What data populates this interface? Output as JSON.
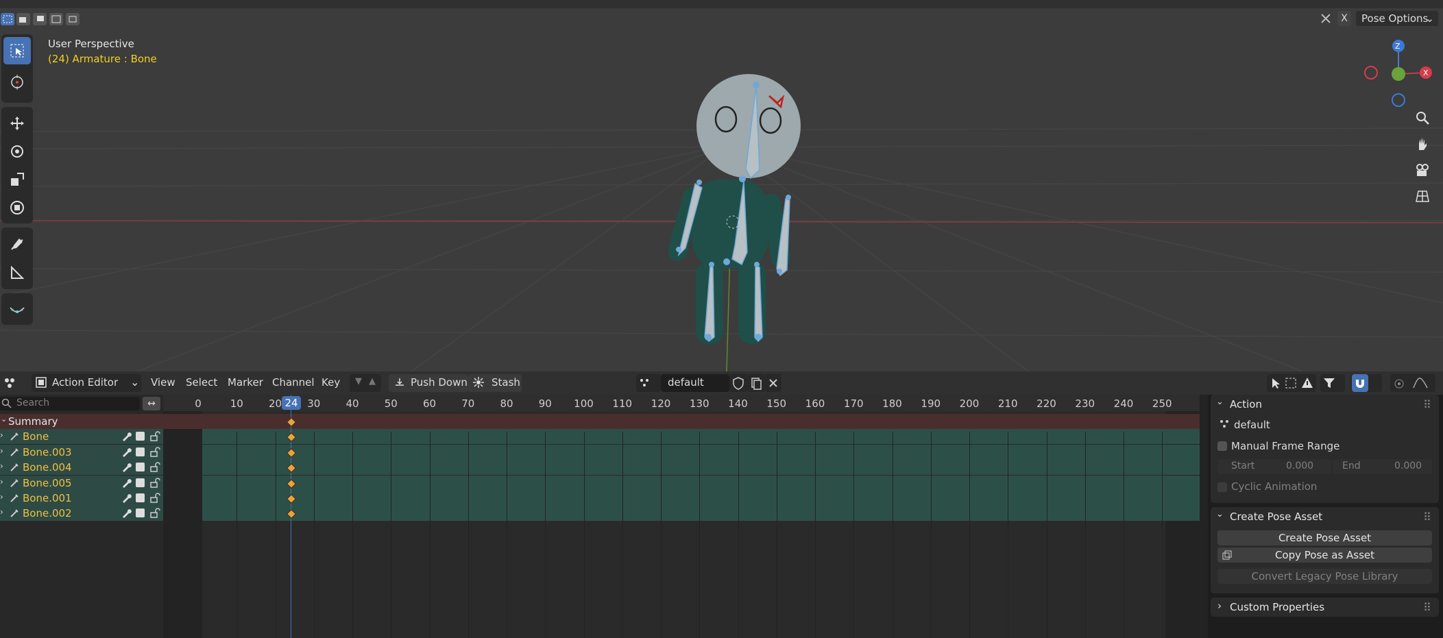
{
  "viewport": {
    "title": "User Perspective",
    "subtitle": "(24) Armature : Bone",
    "mode_label": "Pose Options",
    "x_label": "X",
    "axis_labels": {
      "z": "Z",
      "x": "X"
    }
  },
  "editor": {
    "editor_type": "Action Editor",
    "menus": [
      "View",
      "Select",
      "Marker",
      "Channel",
      "Key"
    ],
    "push_down": "Push Down",
    "stash": "Stash",
    "action_name": "default",
    "search_placeholder": "Search",
    "current_frame": "24",
    "frame_ticks": [
      "0",
      "10",
      "20",
      "30",
      "40",
      "50",
      "60",
      "70",
      "80",
      "90",
      "100",
      "110",
      "120",
      "130",
      "140",
      "150",
      "160",
      "170",
      "180",
      "190",
      "200",
      "210",
      "220",
      "230",
      "240",
      "250"
    ],
    "summary_label": "Summary",
    "channels": [
      "Bone",
      "Bone.003",
      "Bone.004",
      "Bone.005",
      "Bone.001",
      "Bone.002"
    ]
  },
  "sidebar": {
    "action_panel": {
      "title": "Action",
      "action_name": "default",
      "manual_frame_range": "Manual Frame Range",
      "start_label": "Start",
      "start_value": "0.000",
      "end_label": "End",
      "end_value": "0.000",
      "cyclic": "Cyclic Animation"
    },
    "pose_asset_panel": {
      "title": "Create Pose Asset",
      "create_button": "Create Pose Asset",
      "copy_button": "Copy Pose as Asset",
      "convert_button": "Convert Legacy Pose Library"
    },
    "custom_props": "Custom Properties"
  },
  "colors": {
    "accent": "#4772b3",
    "keyframe": "#e8a33a",
    "bone_name": "#f0c040",
    "summary_row": "#4a2e2e",
    "channel_row": "#2c5048"
  }
}
